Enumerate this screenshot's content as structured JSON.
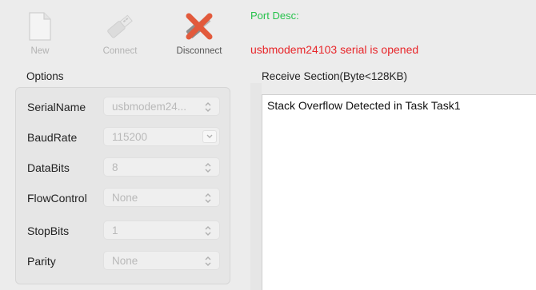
{
  "toolbar": {
    "new_label": "New",
    "connect_label": "Connect",
    "disconnect_label": "Disconnect"
  },
  "port": {
    "desc": "Port Desc:",
    "status": "usbmodem24103 serial is opened"
  },
  "options": {
    "title": "Options",
    "rows": [
      {
        "label": "SerialName",
        "value": "usbmodem24...",
        "control": "chevron-updown"
      },
      {
        "label": "BaudRate",
        "value": "115200",
        "control": "chevron-down"
      },
      {
        "label": "DataBits",
        "value": "8",
        "control": "chevron-updown"
      },
      {
        "label": "FlowControl",
        "value": "None",
        "control": "chevron-updown"
      },
      {
        "label": "StopBits",
        "value": "1",
        "control": "chevron-updown"
      },
      {
        "label": "Parity",
        "value": "None",
        "control": "chevron-updown"
      }
    ]
  },
  "receive": {
    "title": "Receive Section(Byte<128KB)",
    "content": "Stack Overflow Detected in Task Task1"
  },
  "colors": {
    "port_desc": "#27c24c",
    "status_error": "#e8262a",
    "disconnect_red": "#e25a3c"
  }
}
